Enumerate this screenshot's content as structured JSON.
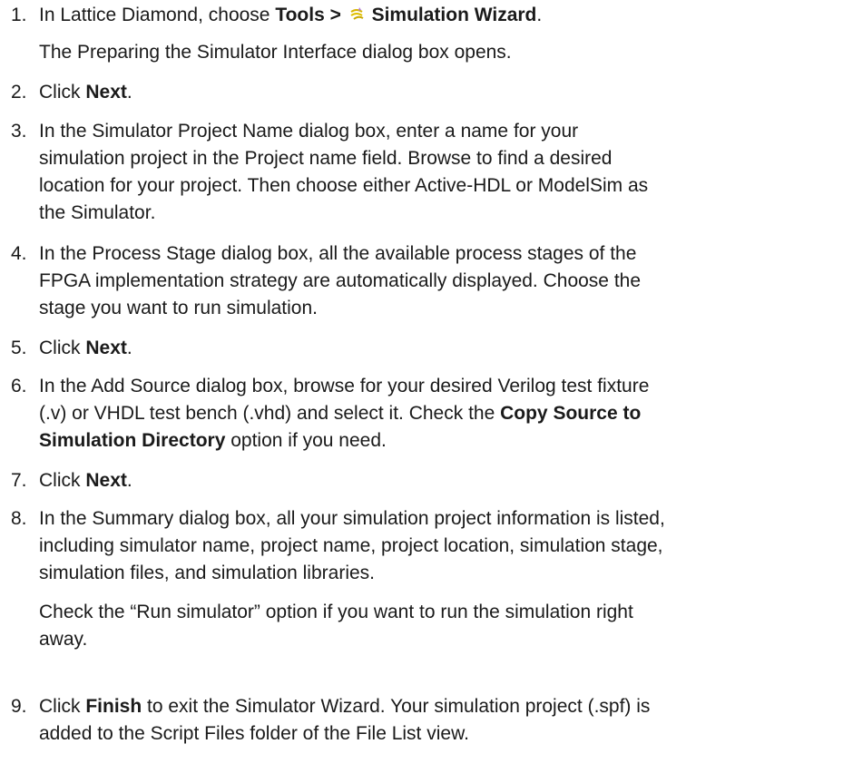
{
  "steps": [
    {
      "num": "1.",
      "pre": "In Lattice Diamond, choose ",
      "bold1": "Tools >",
      "icon": "simulation-wizard-icon",
      "bold2": "Simulation Wizard",
      "post": ".",
      "sub": "The Preparing the Simulator Interface dialog box opens."
    },
    {
      "num": "2.",
      "pre": "Click ",
      "bold": "Next",
      "post": "."
    },
    {
      "num": "3.",
      "lines": [
        "In the Simulator Project Name dialog box, enter a name for your",
        "simulation project in the Project name field. Browse to find a desired",
        "location for your project. Then choose either Active-HDL or ModelSim as",
        "the Simulator."
      ]
    },
    {
      "num": "4.",
      "lines": [
        "In the Process Stage dialog box, all the available process stages of the",
        "FPGA implementation strategy are automatically displayed. Choose the",
        "stage you want to run simulation."
      ]
    },
    {
      "num": "5.",
      "pre": "Click ",
      "bold": "Next",
      "post": "."
    },
    {
      "num": "6.",
      "line1": "In the Add Source dialog box, browse for your desired Verilog test fixture",
      "line2_pre": "(.v) or VHDL test bench (.vhd) and select it. Check the ",
      "line2_bold": "Copy Source to",
      "line3_bold": "Simulation Directory",
      "line3_post": " option if you need."
    },
    {
      "num": "7.",
      "pre": "Click ",
      "bold": "Next",
      "post": "."
    },
    {
      "num": "8.",
      "lines": [
        "In the Summary dialog box, all your simulation project information is listed,",
        "including simulator name, project name, project location, simulation stage,",
        "simulation files, and simulation libraries."
      ],
      "sub_lines": [
        "Check the “Run simulator” option if you want to run the simulation right",
        "away."
      ]
    },
    {
      "num": "9.",
      "pre": "Click ",
      "bold": "Finish",
      "post1": " to exit the Simulator Wizard. Your simulation project (.spf) is",
      "line2": "added to the Script Files folder of the File List view."
    }
  ]
}
